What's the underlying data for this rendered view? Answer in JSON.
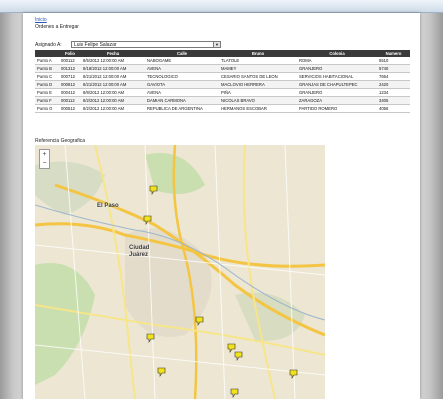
{
  "header": {
    "link_text": "Inicio",
    "subtitle": "Ordenes a Entregar"
  },
  "assign": {
    "label": "Asignado A:",
    "selected": "Luis Felipe Salazar"
  },
  "table": {
    "columns": [
      "",
      "Folio",
      "Fecha",
      "Calle",
      "Bruno",
      "Colonia",
      "Numero"
    ],
    "rows": [
      [
        "Punto A",
        "000112",
        "8/5/2012 12:00:00 AM",
        "NABOGAME",
        "TLATOLE",
        "ROMA",
        "5510"
      ],
      [
        "Punto B",
        "001312",
        "8/18/2012 12:00:00 AM",
        "AVENA",
        "MAMEY",
        "GRANJERO",
        "5740"
      ],
      [
        "Punto C",
        "000712",
        "8/21/2012 12:00:00 AM",
        "TECNOLOGICO",
        "CESARIO SANTOS DE LEON",
        "SERVICIOS HABITACIONAL",
        "7664"
      ],
      [
        "Punto D",
        "000812",
        "8/21/2012 12:00:00 AM",
        "GAVIOTA",
        "MACLOVIO HERRERA",
        "GRANJAS DE CHAPULTEPEC",
        "2420"
      ],
      [
        "Punto E",
        "000412",
        "8/8/2012 12:00:00 AM",
        "AVENA",
        "PIÑA",
        "GRANJERO",
        "1234"
      ],
      [
        "Punto F",
        "000112",
        "8/2/2012 12:00:00 AM",
        "DAMIAN CARMONA",
        "NICOLAS BRAVO",
        "ZARAGOZA",
        "3405"
      ],
      [
        "Punto G",
        "000512",
        "8/2/2012 12:00:00 AM",
        "REPUBLICA DE ARGENTINA",
        "HERMANOS ESCOBAR",
        "PARTIDO ROMERO",
        "4056"
      ]
    ]
  },
  "map": {
    "label": "Referencia Geografica",
    "cities": [
      "El Paso",
      "Ciudad Juárez"
    ],
    "zoom_in": "+",
    "zoom_out": "−",
    "marker_color": "#f2e21a",
    "icons": [
      "map-pin-icon",
      "zoom-in-icon",
      "zoom-out-icon",
      "dropdown-arrow-icon"
    ]
  },
  "colors": {
    "header_bg": "#3a3a3a",
    "link": "#2a56b8",
    "map_land": "#ece6d3",
    "map_green": "#c9dfaf"
  }
}
